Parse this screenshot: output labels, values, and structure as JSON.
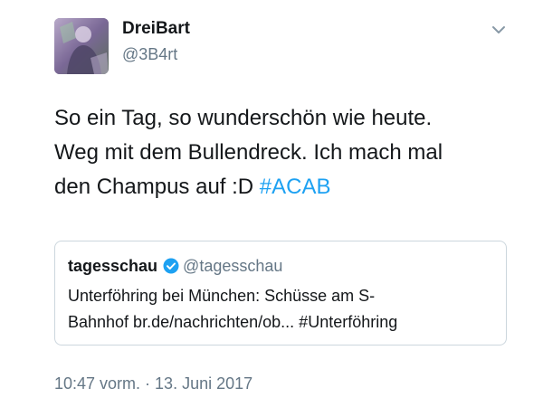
{
  "tweet": {
    "author": {
      "display_name": "DreiBart",
      "handle": "@3B4rt",
      "avatar_icon": "avatar-image"
    },
    "menu_icon": "chevron-down-icon",
    "text_lines": [
      "So ein Tag, so wunderschön wie heute.",
      "Weg mit dem Bullendreck. Ich mach mal",
      "den Champus auf :D "
    ],
    "hashtag": "#ACAB",
    "quoted": {
      "name": "tagesschau",
      "verified_icon": "verified-badge-icon",
      "handle": "@tagesschau",
      "text_lines": [
        "Unterföhring bei München: Schüsse am S-",
        "Bahnhof br.de/nachrichten/ob... #Unterföhring"
      ]
    },
    "timestamp": "10:47 vorm. · 13. Juni 2017"
  },
  "colors": {
    "text": "#14171a",
    "muted": "#657786",
    "link": "#1da1f2",
    "border": "#ccd6dd"
  }
}
